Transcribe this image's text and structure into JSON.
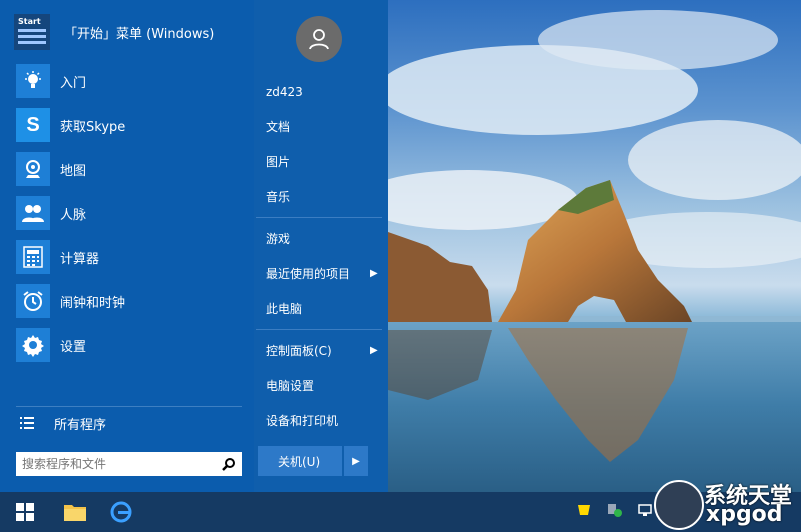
{
  "start_menu": {
    "title": "「开始」菜单 (Windows)",
    "tile_text": "Start",
    "apps": [
      {
        "label": "入门",
        "icon": "lightbulb-icon"
      },
      {
        "label": "获取Skype",
        "icon": "skype-icon"
      },
      {
        "label": "地图",
        "icon": "maps-icon"
      },
      {
        "label": "人脉",
        "icon": "people-icon"
      },
      {
        "label": "计算器",
        "icon": "calculator-icon"
      },
      {
        "label": "闹钟和时钟",
        "icon": "alarm-clock-icon"
      },
      {
        "label": "设置",
        "icon": "gear-icon"
      }
    ],
    "all_programs": "所有程序",
    "search_placeholder": "搜索程序和文件"
  },
  "right_panel": {
    "username": "zd423",
    "items_group1": [
      "文档",
      "图片",
      "音乐"
    ],
    "items_group2": [
      {
        "label": "游戏",
        "has_arrow": false
      },
      {
        "label": "最近使用的项目",
        "has_arrow": true
      },
      {
        "label": "此电脑",
        "has_arrow": false
      }
    ],
    "items_group3": [
      {
        "label": "控制面板(C)",
        "has_arrow": true
      },
      {
        "label": "电脑设置",
        "has_arrow": false
      },
      {
        "label": "设备和打印机",
        "has_arrow": false
      }
    ],
    "shutdown_label": "关机(U)"
  },
  "watermark": {
    "line1": "系统天堂",
    "line2": "xpgod"
  },
  "colors": {
    "menu_bg": "#0b5cad",
    "tile_bg": "#1e7fd6",
    "taskbar_bg": "#153a63"
  }
}
